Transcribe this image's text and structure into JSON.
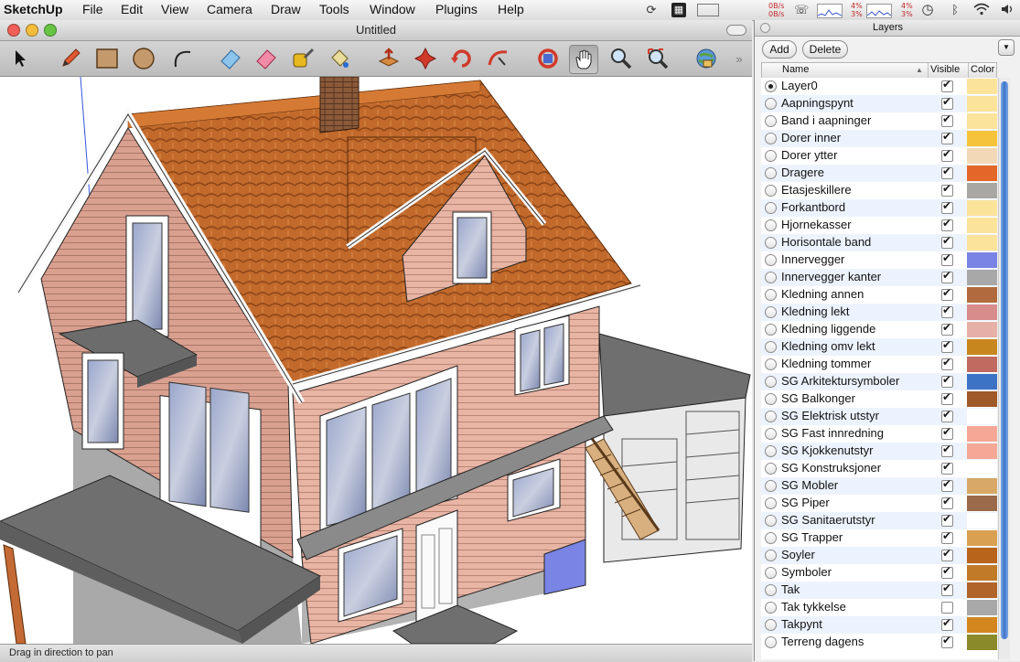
{
  "menubar": {
    "app": "SketchUp",
    "items": [
      "File",
      "Edit",
      "View",
      "Camera",
      "Draw",
      "Tools",
      "Window",
      "Plugins",
      "Help"
    ],
    "net_up": "0B/s",
    "net_down": "0B/s",
    "cpu1": "4%",
    "cpu1b": "3%",
    "cpu2": "4%",
    "cpu2b": "3%"
  },
  "window": {
    "title": "Untitled",
    "status": "Drag in direction to pan"
  },
  "toolbar": {
    "tools": [
      "select-icon",
      "pencil-icon",
      "rectangle-icon",
      "circle-icon",
      "arc-icon",
      "eraser-icon",
      "eraser2-icon",
      "tape-measure-icon",
      "paint-bucket-icon",
      "push-pull-icon",
      "move-icon",
      "rotate-icon",
      "follow-me-icon",
      "orbit-icon",
      "pan-icon",
      "zoom-icon",
      "zoom-extents-icon",
      "get-models-icon"
    ]
  },
  "layers_panel": {
    "title": "Layers",
    "add_label": "Add",
    "delete_label": "Delete",
    "col_name": "Name",
    "col_visible": "Visible",
    "col_color": "Color",
    "layers": [
      {
        "name": "Layer0",
        "active": true,
        "visible": true,
        "color": "#fce39a"
      },
      {
        "name": "Aapningspynt",
        "active": false,
        "visible": true,
        "color": "#fce39a"
      },
      {
        "name": "Band i aapninger",
        "active": false,
        "visible": true,
        "color": "#fce39a"
      },
      {
        "name": "Dorer inner",
        "active": false,
        "visible": true,
        "color": "#f5c43a"
      },
      {
        "name": "Dorer ytter",
        "active": false,
        "visible": true,
        "color": "#f3d8b8"
      },
      {
        "name": "Dragere",
        "active": false,
        "visible": true,
        "color": "#e4672a"
      },
      {
        "name": "Etasjeskillere",
        "active": false,
        "visible": true,
        "color": "#a9a7a4"
      },
      {
        "name": "Forkantbord",
        "active": false,
        "visible": true,
        "color": "#fce39a"
      },
      {
        "name": "Hjornekasser",
        "active": false,
        "visible": true,
        "color": "#fce39a"
      },
      {
        "name": "Horisontale band",
        "active": false,
        "visible": true,
        "color": "#fce39a"
      },
      {
        "name": "Innervegger",
        "active": false,
        "visible": true,
        "color": "#7a84e4"
      },
      {
        "name": "Innervegger kanter",
        "active": false,
        "visible": true,
        "color": "#a8a8a8"
      },
      {
        "name": "Kledning annen",
        "active": false,
        "visible": true,
        "color": "#b06a3e"
      },
      {
        "name": "Kledning lekt",
        "active": false,
        "visible": true,
        "color": "#d88c8c"
      },
      {
        "name": "Kledning liggende",
        "active": false,
        "visible": true,
        "color": "#e6b0a6"
      },
      {
        "name": "Kledning omv lekt",
        "active": false,
        "visible": true,
        "color": "#c8861e"
      },
      {
        "name": "Kledning tommer",
        "active": false,
        "visible": true,
        "color": "#c06a60"
      },
      {
        "name": "SG Arkitektursymboler",
        "active": false,
        "visible": true,
        "color": "#3d73c4"
      },
      {
        "name": "SG Balkonger",
        "active": false,
        "visible": true,
        "color": "#a05a2a"
      },
      {
        "name": "SG Elektrisk utstyr",
        "active": false,
        "visible": true,
        "color": "#ffffff"
      },
      {
        "name": "SG Fast innredning",
        "active": false,
        "visible": true,
        "color": "#f5a896"
      },
      {
        "name": "SG Kjokkenutstyr",
        "active": false,
        "visible": true,
        "color": "#f5a896"
      },
      {
        "name": "SG Konstruksjoner",
        "active": false,
        "visible": true,
        "color": "#ffffff"
      },
      {
        "name": "SG Mobler",
        "active": false,
        "visible": true,
        "color": "#d8a866"
      },
      {
        "name": "SG Piper",
        "active": false,
        "visible": true,
        "color": "#9a6a4a"
      },
      {
        "name": "SG Sanitaerutstyr",
        "active": false,
        "visible": true,
        "color": "#ffffff"
      },
      {
        "name": "SG Trapper",
        "active": false,
        "visible": true,
        "color": "#d8a050"
      },
      {
        "name": "Soyler",
        "active": false,
        "visible": true,
        "color": "#b8641a"
      },
      {
        "name": "Symboler",
        "active": false,
        "visible": true,
        "color": "#c07a28"
      },
      {
        "name": "Tak",
        "active": false,
        "visible": true,
        "color": "#b0642a"
      },
      {
        "name": "Tak tykkelse",
        "active": false,
        "visible": false,
        "color": "#a8a8a8"
      },
      {
        "name": "Takpynt",
        "active": false,
        "visible": true,
        "color": "#d4861e"
      },
      {
        "name": "Terreng dagens",
        "active": false,
        "visible": true,
        "color": "#8a8a2a"
      }
    ]
  }
}
